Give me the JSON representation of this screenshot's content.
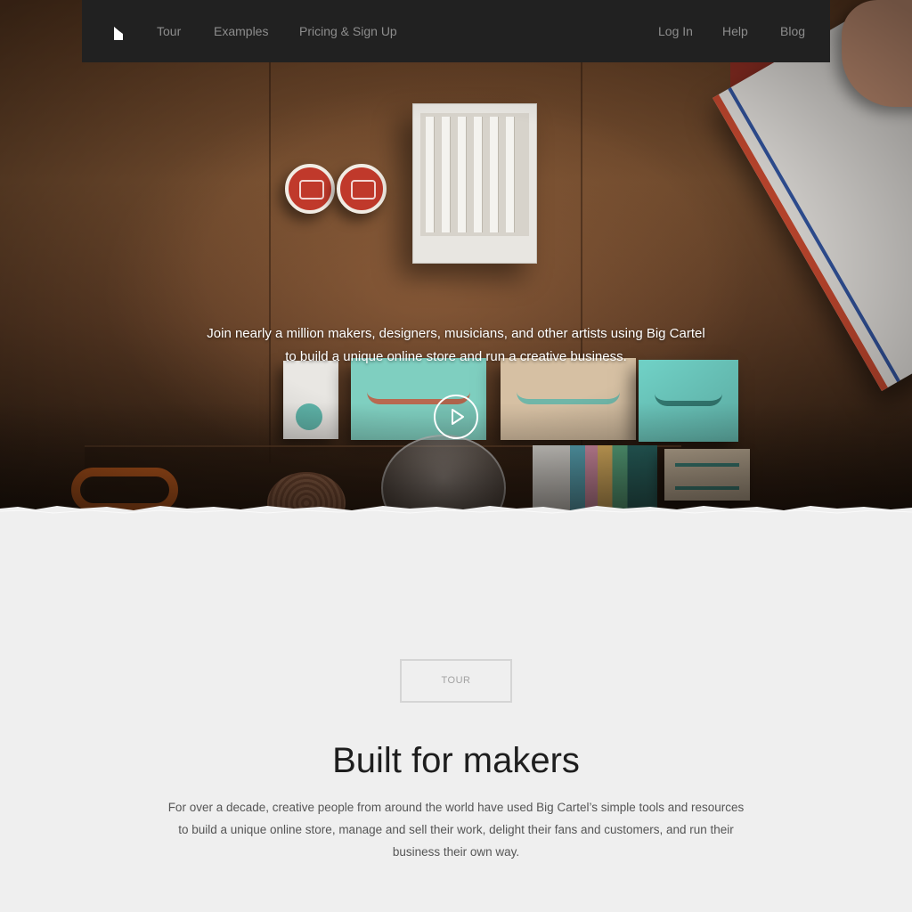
{
  "nav": {
    "logo_icon": "big-cartel-logo",
    "left_links": [
      "Tour",
      "Examples",
      "Pricing & Sign Up"
    ],
    "right_links": [
      "Log In",
      "Help",
      "Blog"
    ]
  },
  "hero": {
    "tagline_line1": "Join nearly a million makers, designers, musicians, and other artists using Big Cartel",
    "tagline_line2": "to build a unique online store and run a creative business.",
    "play_icon": "play-icon"
  },
  "section": {
    "button_label": "Tour",
    "headline": "Built for makers",
    "description": "For over a decade, creative people from around the world have used Big Cartel’s simple tools and resources to build a unique online store, manage and sell their work, delight their fans and customers, and run their business their own way."
  },
  "colors": {
    "nav_bg": "#212121",
    "nav_link": "#8d8d8d",
    "page_bg": "#efefef",
    "headline": "#1e1e1e",
    "body_text": "#555555"
  }
}
